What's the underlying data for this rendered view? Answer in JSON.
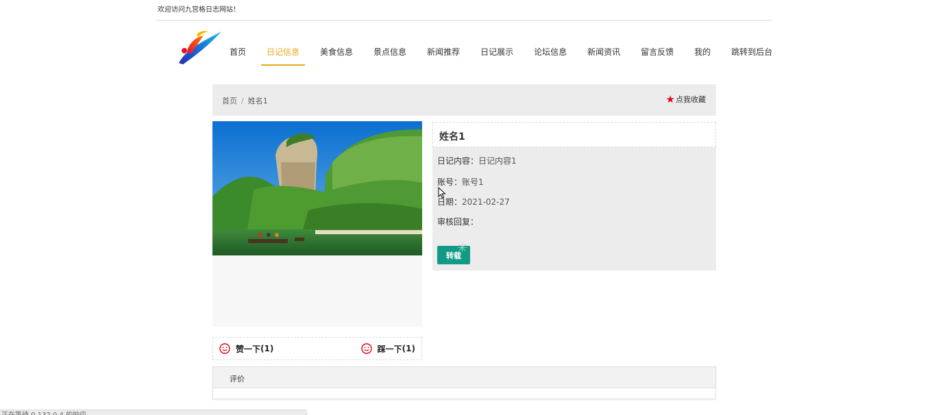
{
  "topbar": {
    "welcome": "欢迎访问九宫格日志网站！"
  },
  "nav": {
    "items": [
      {
        "label": "首页",
        "active": false
      },
      {
        "label": "日记信息",
        "active": true
      },
      {
        "label": "美食信息",
        "active": false
      },
      {
        "label": "景点信息",
        "active": false
      },
      {
        "label": "新闻推荐",
        "active": false
      },
      {
        "label": "日记展示",
        "active": false
      },
      {
        "label": "论坛信息",
        "active": false
      },
      {
        "label": "新闻资讯",
        "active": false
      },
      {
        "label": "留言反馈",
        "active": false
      },
      {
        "label": "我的",
        "active": false
      },
      {
        "label": "跳转到后台",
        "active": false
      }
    ]
  },
  "breadcrumb": {
    "home": "首页",
    "separator": "/",
    "current": "姓名1"
  },
  "favorite": {
    "label": "点我收藏",
    "icon": "star-icon"
  },
  "detail": {
    "title": "姓名1",
    "fields": [
      {
        "key": "日记内容：",
        "value": "日记内容1"
      },
      {
        "key": "账号：",
        "value": "账号1"
      },
      {
        "key": "日期：",
        "value": "2021-02-27"
      },
      {
        "key": "审核回复：",
        "value": ""
      }
    ],
    "repost_label": "转载"
  },
  "votes": {
    "like": {
      "label": "赞一下",
      "count": "(1)",
      "icon": "smile-icon"
    },
    "dislike": {
      "label": "踩一下",
      "count": "(1)",
      "icon": "smile-icon"
    }
  },
  "comments": {
    "header": "评价"
  },
  "status": {
    "text": "正在等待 0.132.0.4 的响应..."
  },
  "colors": {
    "accent": "#e6a817",
    "button": "#139a86",
    "star": "#e60012"
  }
}
